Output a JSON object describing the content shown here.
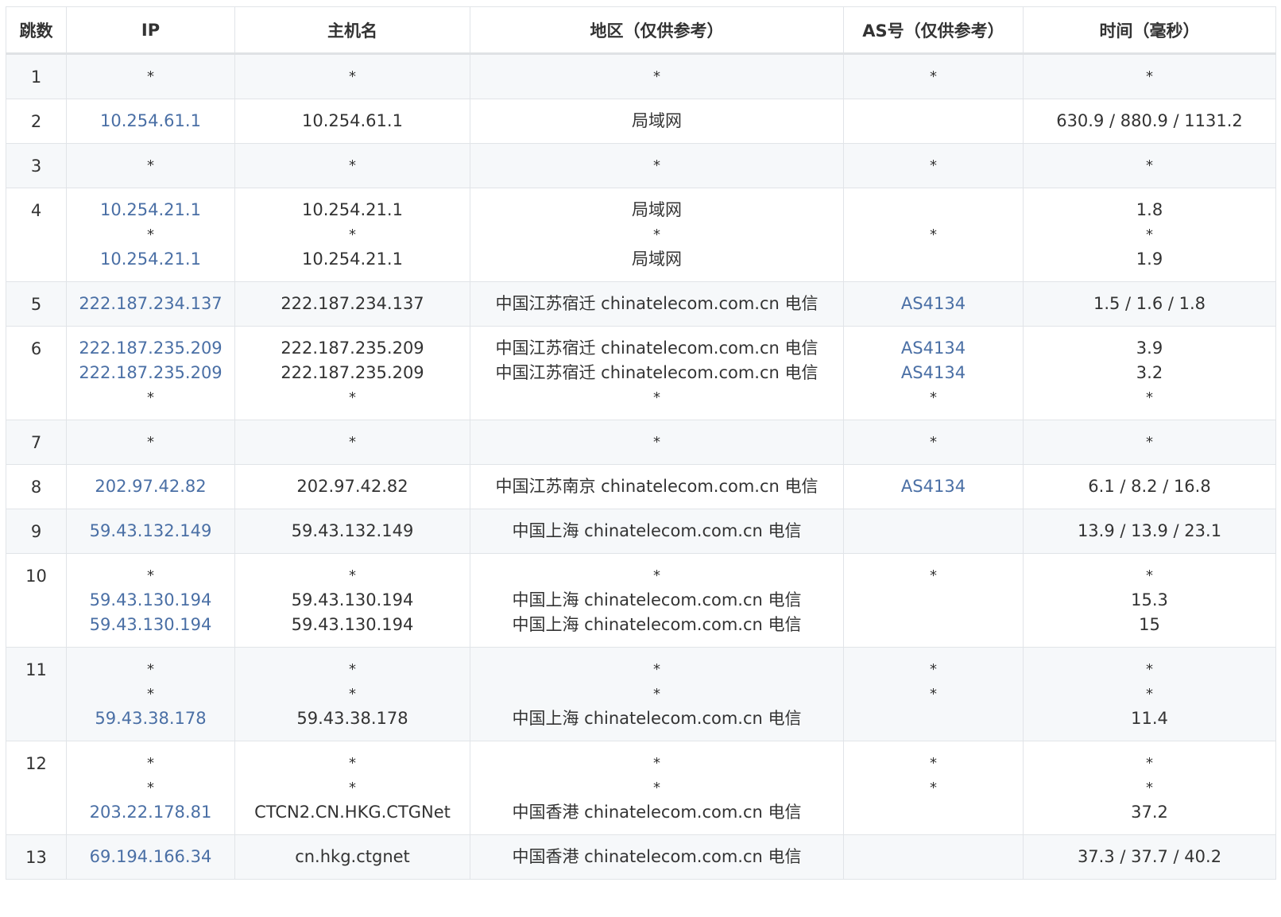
{
  "headers": {
    "hop": "跳数",
    "ip": "IP",
    "host": "主机名",
    "region": "地区（仅供参考）",
    "asn": "AS号（仅供参考）",
    "time": "时间（毫秒）"
  },
  "colors": {
    "link": "#4a6fa5",
    "text": "#333333",
    "row_alt": "#f6f8fa",
    "border": "#e1e4e8"
  },
  "rows": [
    {
      "hop": "1",
      "ip": [
        "*"
      ],
      "host": [
        "*"
      ],
      "region": [
        "*"
      ],
      "asn": [
        "*"
      ],
      "time": [
        "*"
      ]
    },
    {
      "hop": "2",
      "ip": [
        "10.254.61.1"
      ],
      "host": [
        "10.254.61.1"
      ],
      "region": [
        "局域网"
      ],
      "asn": [
        ""
      ],
      "time": [
        "630.9 / 880.9 / 1131.2"
      ]
    },
    {
      "hop": "3",
      "ip": [
        "*"
      ],
      "host": [
        "*"
      ],
      "region": [
        "*"
      ],
      "asn": [
        "*"
      ],
      "time": [
        "*"
      ]
    },
    {
      "hop": "4",
      "ip": [
        "10.254.21.1",
        "*",
        "10.254.21.1"
      ],
      "host": [
        "10.254.21.1",
        "*",
        "10.254.21.1"
      ],
      "region": [
        "局域网",
        "*",
        "局域网"
      ],
      "asn": [
        "*"
      ],
      "time": [
        "1.8",
        "*",
        "1.9"
      ]
    },
    {
      "hop": "5",
      "ip": [
        "222.187.234.137"
      ],
      "host": [
        "222.187.234.137"
      ],
      "region": [
        "中国江苏宿迁 chinatelecom.com.cn 电信"
      ],
      "asn": [
        "AS4134"
      ],
      "time": [
        "1.5 / 1.6 / 1.8"
      ]
    },
    {
      "hop": "6",
      "ip": [
        "222.187.235.209",
        "222.187.235.209",
        "*"
      ],
      "host": [
        "222.187.235.209",
        "222.187.235.209",
        "*"
      ],
      "region": [
        "中国江苏宿迁 chinatelecom.com.cn 电信",
        "中国江苏宿迁 chinatelecom.com.cn 电信",
        "*"
      ],
      "asn": [
        "AS4134",
        "AS4134",
        "*"
      ],
      "time": [
        "3.9",
        "3.2",
        "*"
      ]
    },
    {
      "hop": "7",
      "ip": [
        "*"
      ],
      "host": [
        "*"
      ],
      "region": [
        "*"
      ],
      "asn": [
        "*"
      ],
      "time": [
        "*"
      ]
    },
    {
      "hop": "8",
      "ip": [
        "202.97.42.82"
      ],
      "host": [
        "202.97.42.82"
      ],
      "region": [
        "中国江苏南京 chinatelecom.com.cn 电信"
      ],
      "asn": [
        "AS4134"
      ],
      "time": [
        "6.1 / 8.2 / 16.8"
      ]
    },
    {
      "hop": "9",
      "ip": [
        "59.43.132.149"
      ],
      "host": [
        "59.43.132.149"
      ],
      "region": [
        "中国上海 chinatelecom.com.cn 电信"
      ],
      "asn": [
        ""
      ],
      "time": [
        "13.9 / 13.9 / 23.1"
      ]
    },
    {
      "hop": "10",
      "ip": [
        "*",
        "59.43.130.194",
        "59.43.130.194"
      ],
      "host": [
        "*",
        "59.43.130.194",
        "59.43.130.194"
      ],
      "region": [
        "*",
        "中国上海 chinatelecom.com.cn 电信",
        "中国上海 chinatelecom.com.cn 电信"
      ],
      "asn": [
        "*",
        "",
        ""
      ],
      "time": [
        "*",
        "15.3",
        "15"
      ]
    },
    {
      "hop": "11",
      "ip": [
        "*",
        "*",
        "59.43.38.178"
      ],
      "host": [
        "*",
        "*",
        "59.43.38.178"
      ],
      "region": [
        "*",
        "*",
        "中国上海 chinatelecom.com.cn 电信"
      ],
      "asn": [
        "*",
        "*",
        ""
      ],
      "time": [
        "*",
        "*",
        "11.4"
      ]
    },
    {
      "hop": "12",
      "ip": [
        "*",
        "*",
        "203.22.178.81"
      ],
      "host": [
        "*",
        "*",
        "CTCN2.CN.HKG.CTGNet"
      ],
      "region": [
        "*",
        "*",
        "中国香港 chinatelecom.com.cn 电信"
      ],
      "asn": [
        "*",
        "*",
        ""
      ],
      "time": [
        "*",
        "*",
        "37.2"
      ]
    },
    {
      "hop": "13",
      "ip": [
        "69.194.166.34"
      ],
      "host": [
        "cn.hkg.ctgnet"
      ],
      "region": [
        "中国香港 chinatelecom.com.cn 电信"
      ],
      "asn": [
        ""
      ],
      "time": [
        "37.3 / 37.7 / 40.2"
      ]
    }
  ]
}
